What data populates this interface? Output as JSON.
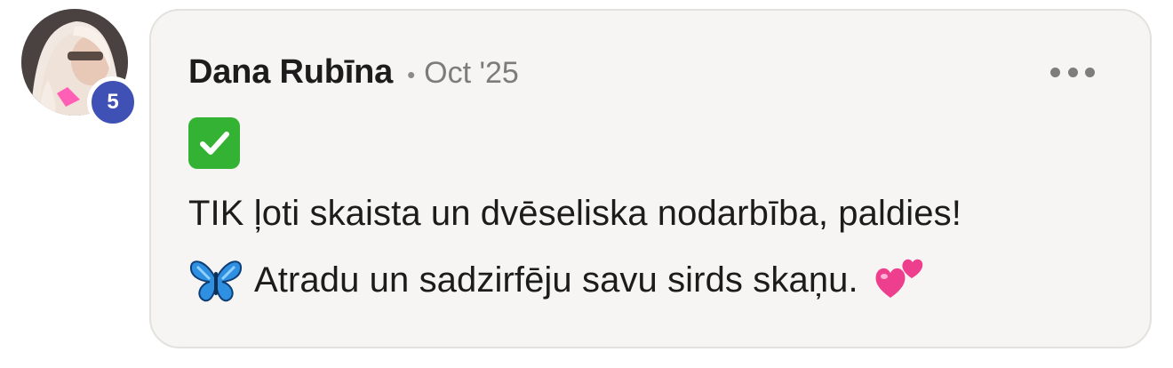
{
  "comment": {
    "author": "Dana Rubīna",
    "separator": "•",
    "date": "Oct '25",
    "level_badge": "5",
    "emoji_top": "check-mark-button-icon",
    "line1": "TIK ļoti skaista un dvēseliska nodarbība, paldies!",
    "line2": "Atradu un sadzirfēju savu sirds skaņu.",
    "line2_leading_icon": "butterfly-icon",
    "line2_trailing_icon": "two-hearts-icon"
  },
  "colors": {
    "bubble_bg": "#f6f5f3",
    "badge": "#3f51b5",
    "check_green": "#34b233",
    "butterfly_blue": "#2f8fe0",
    "heart_pink": "#ee3f8f"
  }
}
